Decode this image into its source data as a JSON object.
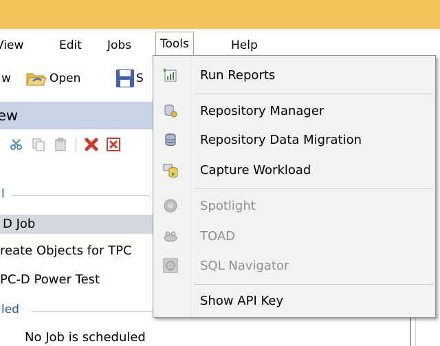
{
  "menubar": {
    "items": [
      {
        "label": "View"
      },
      {
        "label": "Edit"
      },
      {
        "label": "Jobs"
      },
      {
        "label": "Tools"
      },
      {
        "label": "Help"
      }
    ]
  },
  "toolbar": {
    "new_partial": "w",
    "open_label": "Open",
    "save_partial": "S"
  },
  "panel": {
    "title_partial": "ew",
    "group1_label": "l",
    "group2_label": "led",
    "rows": [
      {
        "text": "D Job"
      },
      {
        "text": "reate Objects for TPC"
      },
      {
        "text": "PC-D Power Test"
      }
    ],
    "empty_text": "No Job is scheduled"
  },
  "tools_menu": {
    "items": [
      {
        "label": "Run Reports",
        "enabled": true,
        "icon": "run-reports-icon"
      },
      {
        "label": "Repository Manager",
        "enabled": true,
        "icon": "repository-manager-icon"
      },
      {
        "label": "Repository Data Migration",
        "enabled": true,
        "icon": "database-migration-icon"
      },
      {
        "label": "Capture Workload",
        "enabled": true,
        "icon": "capture-workload-icon"
      },
      {
        "label": "Spotlight",
        "enabled": false,
        "icon": "spotlight-icon"
      },
      {
        "label": "TOAD",
        "enabled": false,
        "icon": "toad-icon"
      },
      {
        "label": "SQL Navigator",
        "enabled": false,
        "icon": "sql-navigator-icon"
      },
      {
        "label": "Show API Key",
        "enabled": true,
        "icon": ""
      }
    ]
  },
  "colors": {
    "titlebar": "#f1c55c",
    "panel_header": "#c9d3e6",
    "group_label": "#2456a8",
    "disabled_text": "#8f8f8f"
  }
}
